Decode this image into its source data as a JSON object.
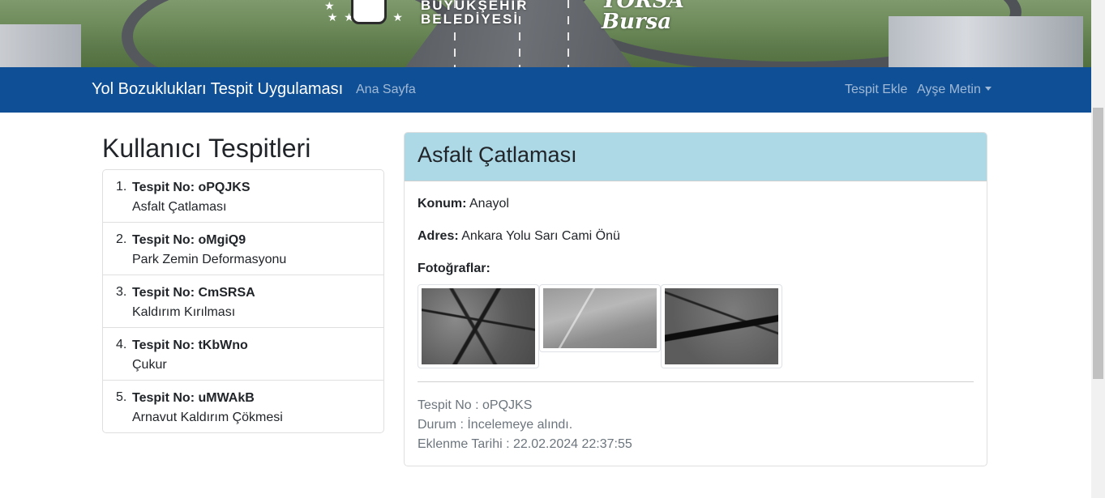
{
  "banner": {
    "logo_text_line1": "BÜYÜKŞEHİR",
    "logo_text_line2": "BELEDİYESİ",
    "brand_logo": "YORSA Bursa"
  },
  "navbar": {
    "brand": "Yol Bozuklukları Tespit Uygulaması",
    "home": "Ana Sayfa",
    "add": "Tespit Ekle",
    "user": "Ayşe Metin",
    "color": "#0f4f96"
  },
  "list": {
    "title": "Kullanıcı Tespitleri",
    "items": [
      {
        "num": "1.",
        "code": "Tespit No: oPQJKS",
        "type": "Asfalt Çatlaması"
      },
      {
        "num": "2.",
        "code": "Tespit No: oMgiQ9",
        "type": "Park Zemin Deformasyonu"
      },
      {
        "num": "3.",
        "code": "Tespit No: CmSRSA",
        "type": "Kaldırım Kırılması"
      },
      {
        "num": "4.",
        "code": "Tespit No: tKbWno",
        "type": "Çukur"
      },
      {
        "num": "5.",
        "code": "Tespit No: uMWAkB",
        "type": "Arnavut Kaldırım Çökmesi"
      }
    ]
  },
  "detail": {
    "title": "Asfalt Çatlaması",
    "header_color": "#add8e6",
    "konum_label": "Konum:",
    "konum_value": "Anayol",
    "adres_label": "Adres:",
    "adres_value": "Ankara Yolu Sarı Cami Önü",
    "photos_label": "Fotoğraflar:",
    "photos": [
      "asphalt-crack-photo-1",
      "road-surface-photo-2",
      "asphalt-crack-photo-3"
    ],
    "tespit_no": "Tespit No : oPQJKS",
    "durum": "Durum : İncelemeye alındı.",
    "tarih": "Eklenme Tarihi : 22.02.2024 22:37:55"
  }
}
